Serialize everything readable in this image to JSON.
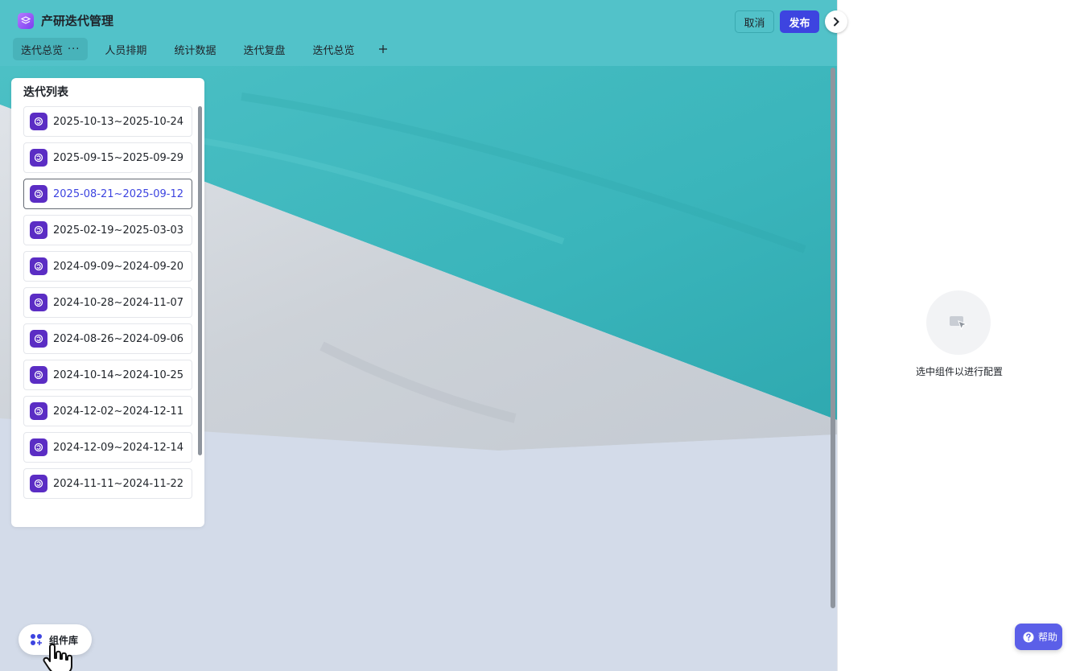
{
  "app": {
    "title": "产研迭代管理"
  },
  "toolbar": {
    "cancel_label": "取消",
    "publish_label": "发布"
  },
  "tabs": [
    {
      "label": "迭代总览",
      "active": true,
      "more": "···"
    },
    {
      "label": "人员排期",
      "active": false
    },
    {
      "label": "统计数据",
      "active": false
    },
    {
      "label": "迭代复盘",
      "active": false
    },
    {
      "label": "迭代总览",
      "active": false
    }
  ],
  "iteration_list": {
    "title": "迭代列表",
    "items": [
      {
        "label": "2025-10-13~2025-10-24",
        "selected": false
      },
      {
        "label": "2025-09-15~2025-09-29",
        "selected": false
      },
      {
        "label": "2025-08-21~2025-09-12",
        "selected": true
      },
      {
        "label": "2025-02-19~2025-03-03",
        "selected": false
      },
      {
        "label": "2024-09-09~2024-09-20",
        "selected": false
      },
      {
        "label": "2024-10-28~2024-11-07",
        "selected": false
      },
      {
        "label": "2024-08-26~2024-09-06",
        "selected": false
      },
      {
        "label": "2024-10-14~2024-10-25",
        "selected": false
      },
      {
        "label": "2024-12-02~2024-12-11",
        "selected": false
      },
      {
        "label": "2024-12-09~2024-12-14",
        "selected": false
      },
      {
        "label": "2024-11-11~2024-11-22",
        "selected": false
      }
    ]
  },
  "component_library": {
    "label": "组件库"
  },
  "config_panel": {
    "empty_text": "选中组件以进行配置"
  },
  "help": {
    "label": "帮助"
  },
  "colors": {
    "topbar": "#52c2c9",
    "primary": "#3d44e0",
    "app_icon": "#7b3df0",
    "item_icon": "#5b2dc4",
    "help": "#5b5fe8"
  }
}
